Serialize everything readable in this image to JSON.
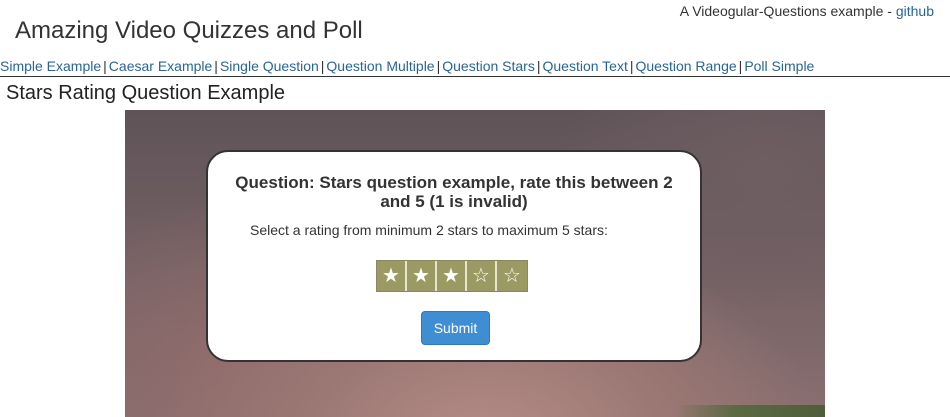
{
  "header": {
    "note_prefix": "A Videogular-Questions example -",
    "note_link": "github",
    "title": "Amazing Video Quizzes and Poll"
  },
  "nav": {
    "items": [
      {
        "label": "Simple Example"
      },
      {
        "label": "Caesar Example"
      },
      {
        "label": "Single Question"
      },
      {
        "label": "Question Multiple"
      },
      {
        "label": "Question Stars"
      },
      {
        "label": "Question Text"
      },
      {
        "label": "Question Range"
      },
      {
        "label": "Poll Simple"
      }
    ],
    "separator": "|"
  },
  "main": {
    "heading": "Stars Rating Question Example"
  },
  "question": {
    "title": "Question: Stars question example, rate this between 2 and 5 (1 is invalid)",
    "help": "Select a rating from minimum 2 stars to maximum 5 stars:",
    "rating": {
      "selected": 3,
      "max": 5,
      "glyphs": [
        "★",
        "★",
        "★",
        "☆",
        "☆"
      ]
    },
    "submit_label": "Submit"
  },
  "colors": {
    "link": "#2a6496",
    "star_bg": "#9c9a63",
    "submit_bg": "#3f8ed4"
  }
}
